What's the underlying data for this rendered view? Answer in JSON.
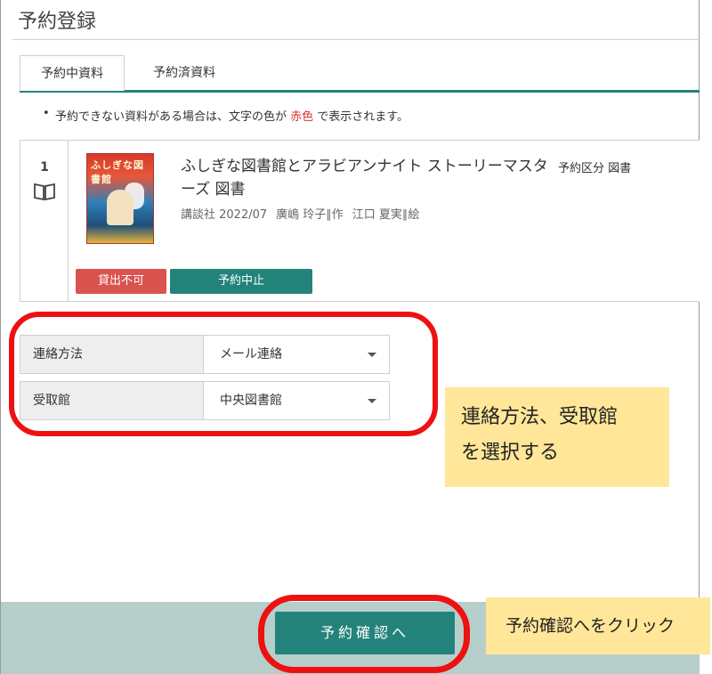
{
  "page": {
    "title": "予約登録"
  },
  "tabs": [
    {
      "label": "予約中資料",
      "active": true
    },
    {
      "label": "予約済資料",
      "active": false
    }
  ],
  "notice": {
    "before": "予約できない資料がある場合は、文字の色が ",
    "highlight": "赤色",
    "after": " で表示されます。"
  },
  "item": {
    "index": "1",
    "icon": "book-icon",
    "cover_text": "ふしぎな図書館",
    "title": "ふしぎな図書館とアラビアンナイト ストーリーマスターズ 図書",
    "publisher": "講談社 2022/07",
    "author": "廣嶋 玲子∥作",
    "illustrator": "江口 夏実∥絵",
    "type": "予約区分 図書",
    "status_label": "貸出不可",
    "cancel_label": "予約中止"
  },
  "form": {
    "contact": {
      "label": "連絡方法",
      "value": "メール連絡"
    },
    "pickup": {
      "label": "受取館",
      "value": "中央図書館"
    }
  },
  "footer": {
    "confirm_label": "予約確認へ"
  },
  "annotations": {
    "form_note_line1": "連絡方法、受取館",
    "form_note_line2": "を選択する",
    "confirm_note": "予約確認へをクリック"
  },
  "colors": {
    "accent": "#23837a",
    "warning": "#d9534f",
    "highlight": "#ee1111",
    "note_bg": "#ffe699"
  }
}
